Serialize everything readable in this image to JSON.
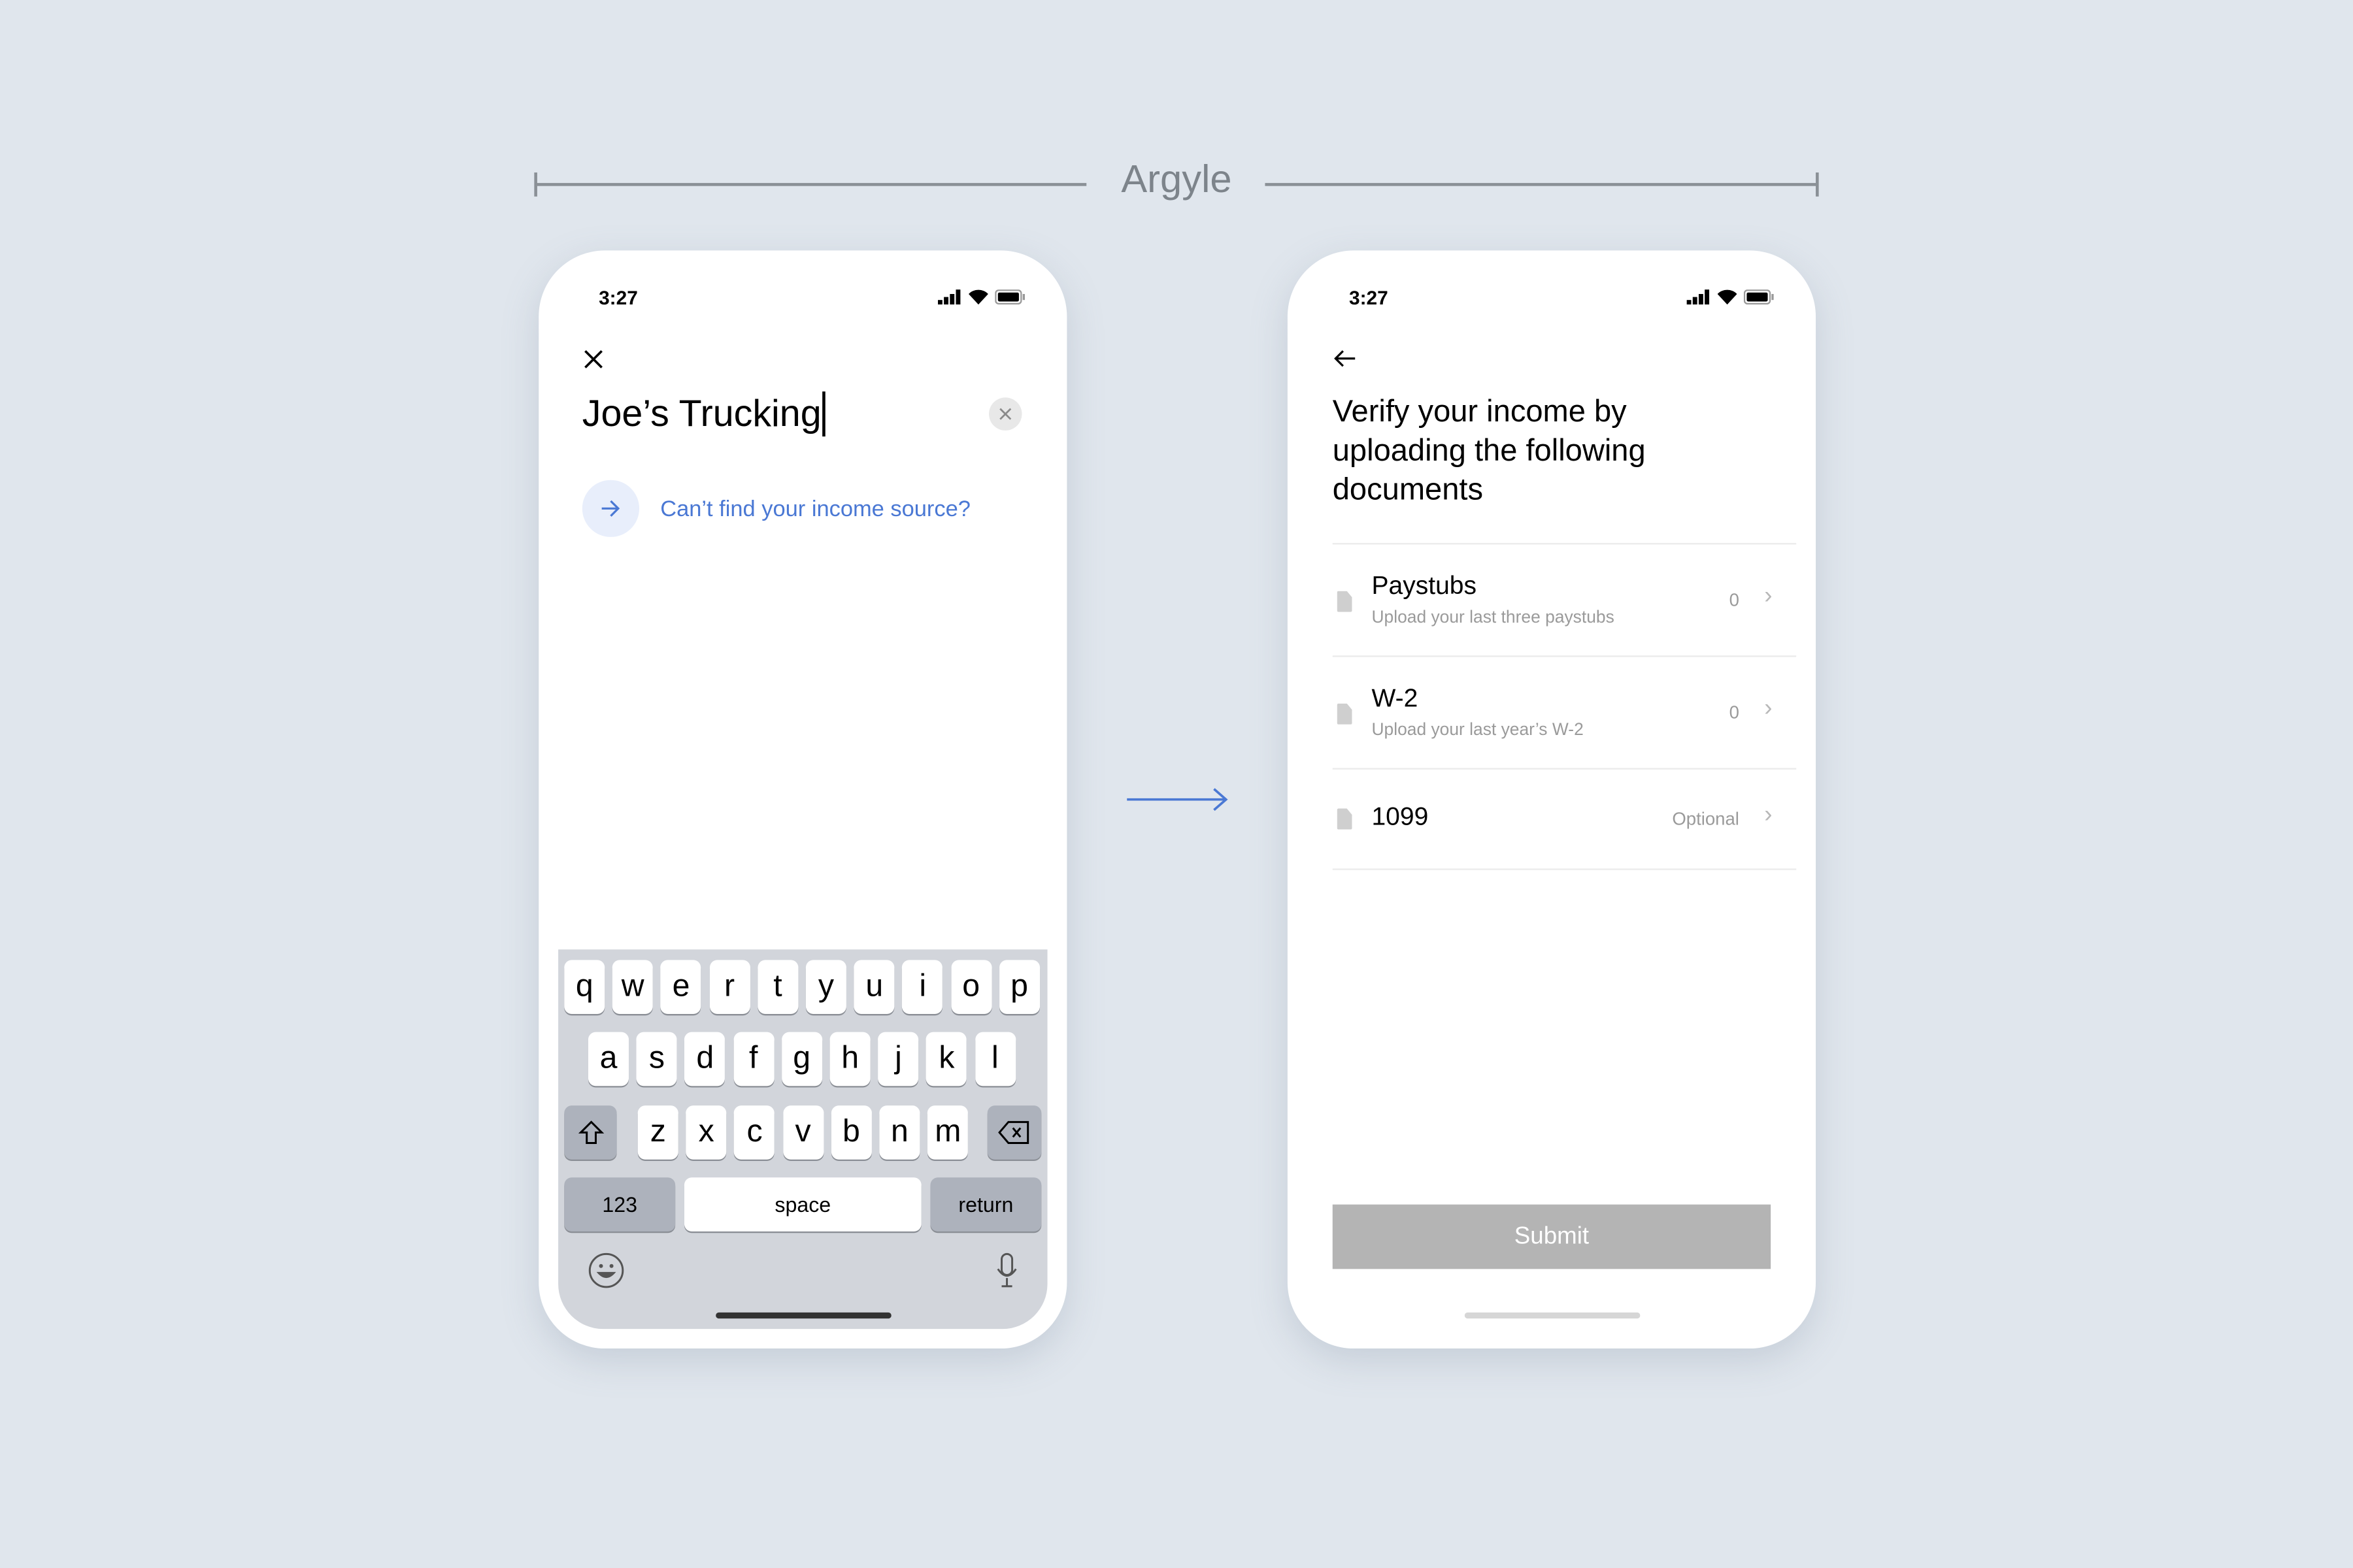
{
  "brand": "Argyle",
  "colors": {
    "accent": "#4a78d4",
    "background": "#e0e6ed",
    "submit_disabled": "#b4b4b4"
  },
  "left_phone": {
    "status": {
      "time": "3:27",
      "icons": [
        "signal-icon",
        "wifi-icon",
        "battery-icon"
      ]
    },
    "close_icon": "close-icon",
    "search": {
      "value": "Joe’s Trucking",
      "clear_icon": "clear-icon"
    },
    "cant_find_link": {
      "label": "Can’t find your income source?",
      "icon": "arrow-right-icon"
    },
    "keyboard": {
      "row1": [
        "q",
        "w",
        "e",
        "r",
        "t",
        "y",
        "u",
        "i",
        "o",
        "p"
      ],
      "row2": [
        "a",
        "s",
        "d",
        "f",
        "g",
        "h",
        "j",
        "k",
        "l"
      ],
      "row3": [
        "z",
        "x",
        "c",
        "v",
        "b",
        "n",
        "m"
      ],
      "shift_icon": "shift-icon",
      "delete_icon": "backspace-icon",
      "numbers_label": "123",
      "space_label": "space",
      "return_label": "return",
      "emoji_icon": "emoji-icon",
      "mic_icon": "microphone-icon"
    }
  },
  "right_phone": {
    "status": {
      "time": "3:27",
      "icons": [
        "signal-icon",
        "wifi-icon",
        "battery-icon"
      ]
    },
    "back_icon": "back-arrow-icon",
    "title": "Verify your income by uploading the following documents",
    "documents": [
      {
        "title": "Paystubs",
        "subtitle": "Upload your last three paystubs",
        "meta": "0"
      },
      {
        "title": "W-2",
        "subtitle": "Upload your last year’s W-2",
        "meta": "0"
      },
      {
        "title": "1099",
        "subtitle": "",
        "meta": "Optional"
      }
    ],
    "submit_label": "Submit"
  }
}
